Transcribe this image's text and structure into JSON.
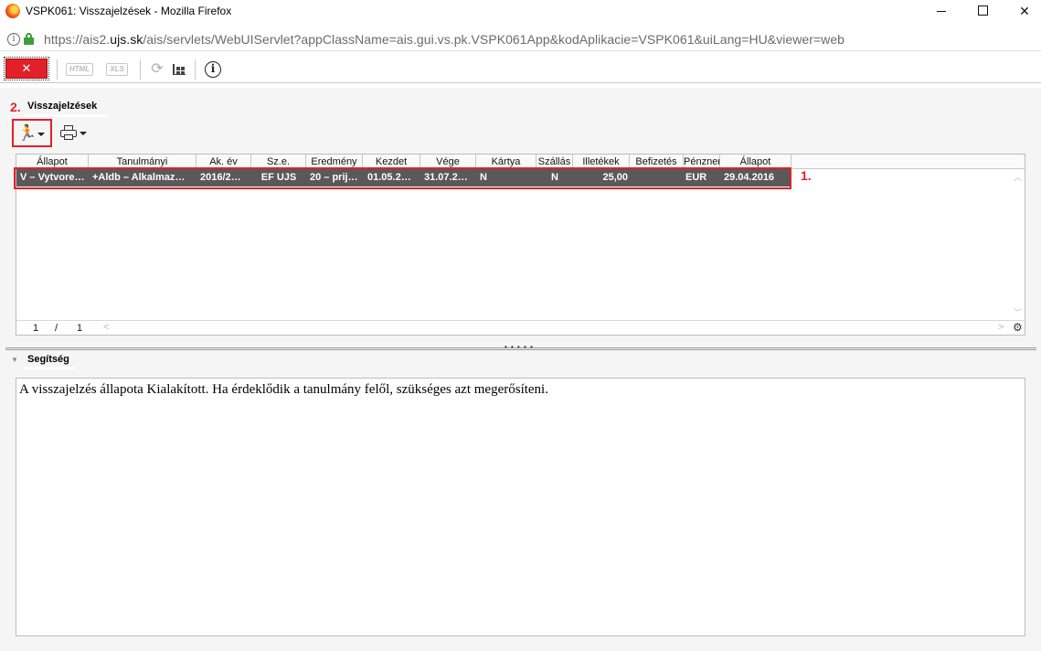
{
  "window": {
    "title": "VSPK061: Visszajelzések - Mozilla Firefox",
    "minimize": "—",
    "maximize": "☐",
    "close": "✕"
  },
  "urlbar": {
    "url_prefix": "https://ais2.",
    "url_domain": "ujs.sk",
    "url_rest": "/ais/servlets/WebUIServlet?appClassName=ais.gui.vs.pk.VSPK061App&kodAplikacie=VSPK061&uiLang=HU&viewer=web"
  },
  "toolbar": {
    "close_label": "✕",
    "html_label": "HTML",
    "xls_label": "XLS",
    "refresh_icon": "⟳",
    "info_label": "i"
  },
  "markers": {
    "row_marker": "1.",
    "button_marker": "2."
  },
  "tab": {
    "title": "Visszajelzések"
  },
  "actions": {
    "run_icon": "🏃"
  },
  "table": {
    "headers": [
      "Állapot",
      "Tanulmányi",
      "Ak. év",
      "Sz.e.",
      "Eredmény",
      "Kezdet",
      "Vége",
      "Kártya",
      "Szállás",
      "Illetékek",
      "Befizetés",
      "Pénznem",
      "Állapot"
    ],
    "row": [
      "V – Vytvore…",
      "+Aldb – Alkalmaz…",
      "2016/2…",
      "EF UJS",
      "20 – prij…",
      "01.05.2…",
      "31.07.2…",
      "N",
      "N",
      "25,00",
      "",
      "EUR",
      "29.04.2016"
    ],
    "page_current": "1",
    "page_sep": "/",
    "page_total": "1"
  },
  "help": {
    "title": "Segítség",
    "text": "A visszajelzés állapota Kialakított. Ha érdeklődik a tanulmány felől, szükséges azt megerősíteni."
  },
  "colors": {
    "accent_red": "#e3202a",
    "selected_row": "#595959",
    "lock_green": "#3a9e3a"
  }
}
